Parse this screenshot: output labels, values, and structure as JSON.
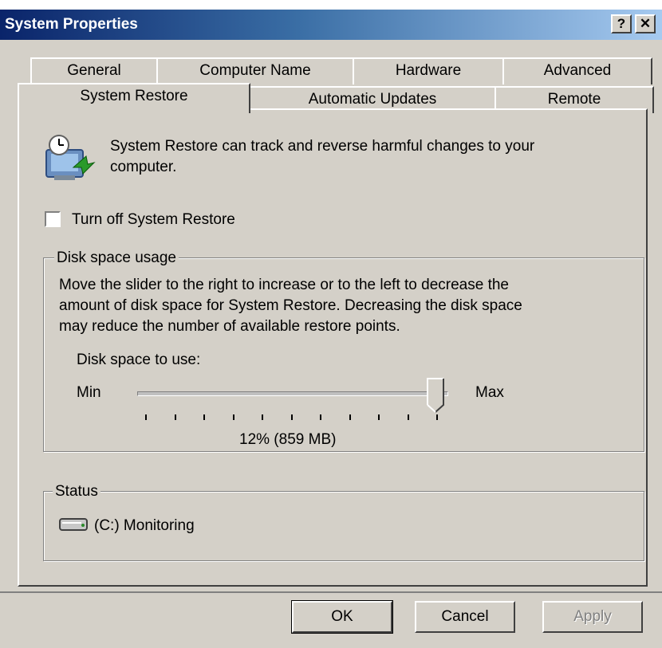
{
  "window": {
    "title": "System Properties",
    "help_glyph": "?",
    "close_glyph": "✕"
  },
  "tabs_row1": [
    "General",
    "Computer Name",
    "Hardware",
    "Advanced"
  ],
  "tabs_row2": [
    "System Restore",
    "Automatic Updates",
    "Remote"
  ],
  "active_tab": "System Restore",
  "intro": {
    "line1": "System Restore can track and reverse harmful changes to your",
    "line2": "computer.",
    "icon": "system-restore-icon"
  },
  "turn_off": {
    "label": "Turn off System Restore",
    "checked": false
  },
  "disk_space": {
    "group_title": "Disk space usage",
    "desc_line1": "Move the slider to the right to increase or to the left to decrease the",
    "desc_line2": "amount of disk space for System Restore. Decreasing the disk space",
    "desc_line3": "may reduce the number of available restore points.",
    "label": "Disk space to use:",
    "min_label": "Min",
    "max_label": "Max",
    "value_text": "12% (859 MB)",
    "slider_level": 1.0
  },
  "status": {
    "group_title": "Status",
    "drive_text": "(C:) Monitoring",
    "icon": "drive-icon"
  },
  "buttons": {
    "ok": "OK",
    "cancel": "Cancel",
    "apply": "Apply"
  },
  "colors": {
    "face": "#d4d0c8",
    "title_start": "#0a246a",
    "title_end": "#a6caf0"
  }
}
